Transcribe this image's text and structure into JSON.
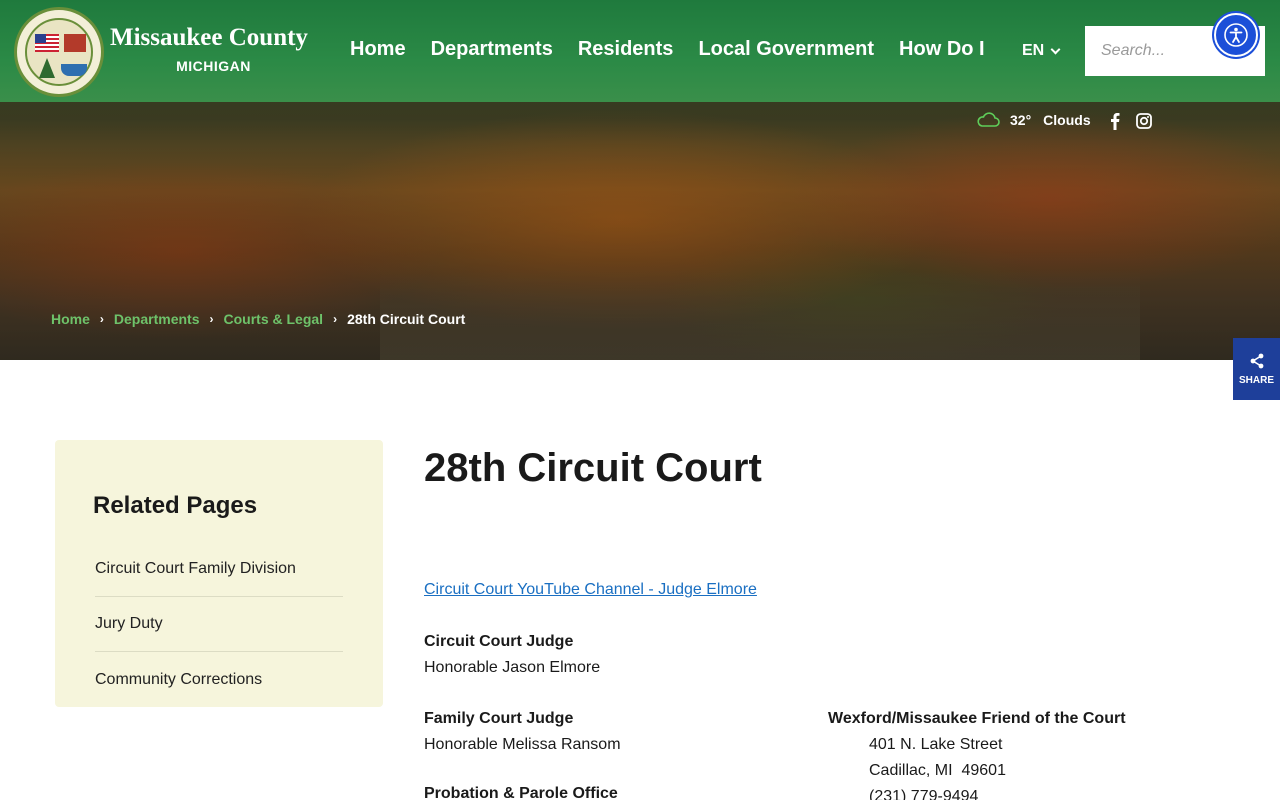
{
  "header": {
    "title": "Missaukee County",
    "subtitle": "MICHIGAN",
    "nav": [
      "Home",
      "Departments",
      "Residents",
      "Local Government",
      "How Do I"
    ],
    "language": "EN",
    "search_placeholder": "Search..."
  },
  "weather": {
    "temperature": "32°",
    "condition": "Clouds"
  },
  "breadcrumb": {
    "links": [
      "Home",
      "Departments",
      "Courts & Legal"
    ],
    "current": "28th Circuit Court"
  },
  "share_label": "SHARE",
  "sidebar": {
    "title": "Related Pages",
    "items": [
      "Circuit Court Family Division",
      "Jury Duty",
      "Community Corrections"
    ]
  },
  "main": {
    "title": "28th Circuit Court",
    "youtube_link": "Circuit Court YouTube Channel - Judge Elmore",
    "circuit_judge": {
      "label": "Circuit Court Judge",
      "name": "Honorable Jason Elmore"
    },
    "family_judge": {
      "label": "Family Court Judge",
      "name": "Honorable Melissa Ransom"
    },
    "friend_of_court": {
      "label": "Wexford/Missaukee Friend of the Court",
      "address1": "401 N. Lake Street",
      "address2": "Cadillac, MI  49601",
      "phone": "(231) 779-9494"
    },
    "probation": {
      "label": "Probation & Parole Office"
    }
  },
  "colors": {
    "header_green": "#2b8a46",
    "link_green": "#6ec26a",
    "share_blue": "#1e3f9a",
    "sidebar_bg": "#f6f5dc",
    "link_blue": "#1a6fc2"
  }
}
